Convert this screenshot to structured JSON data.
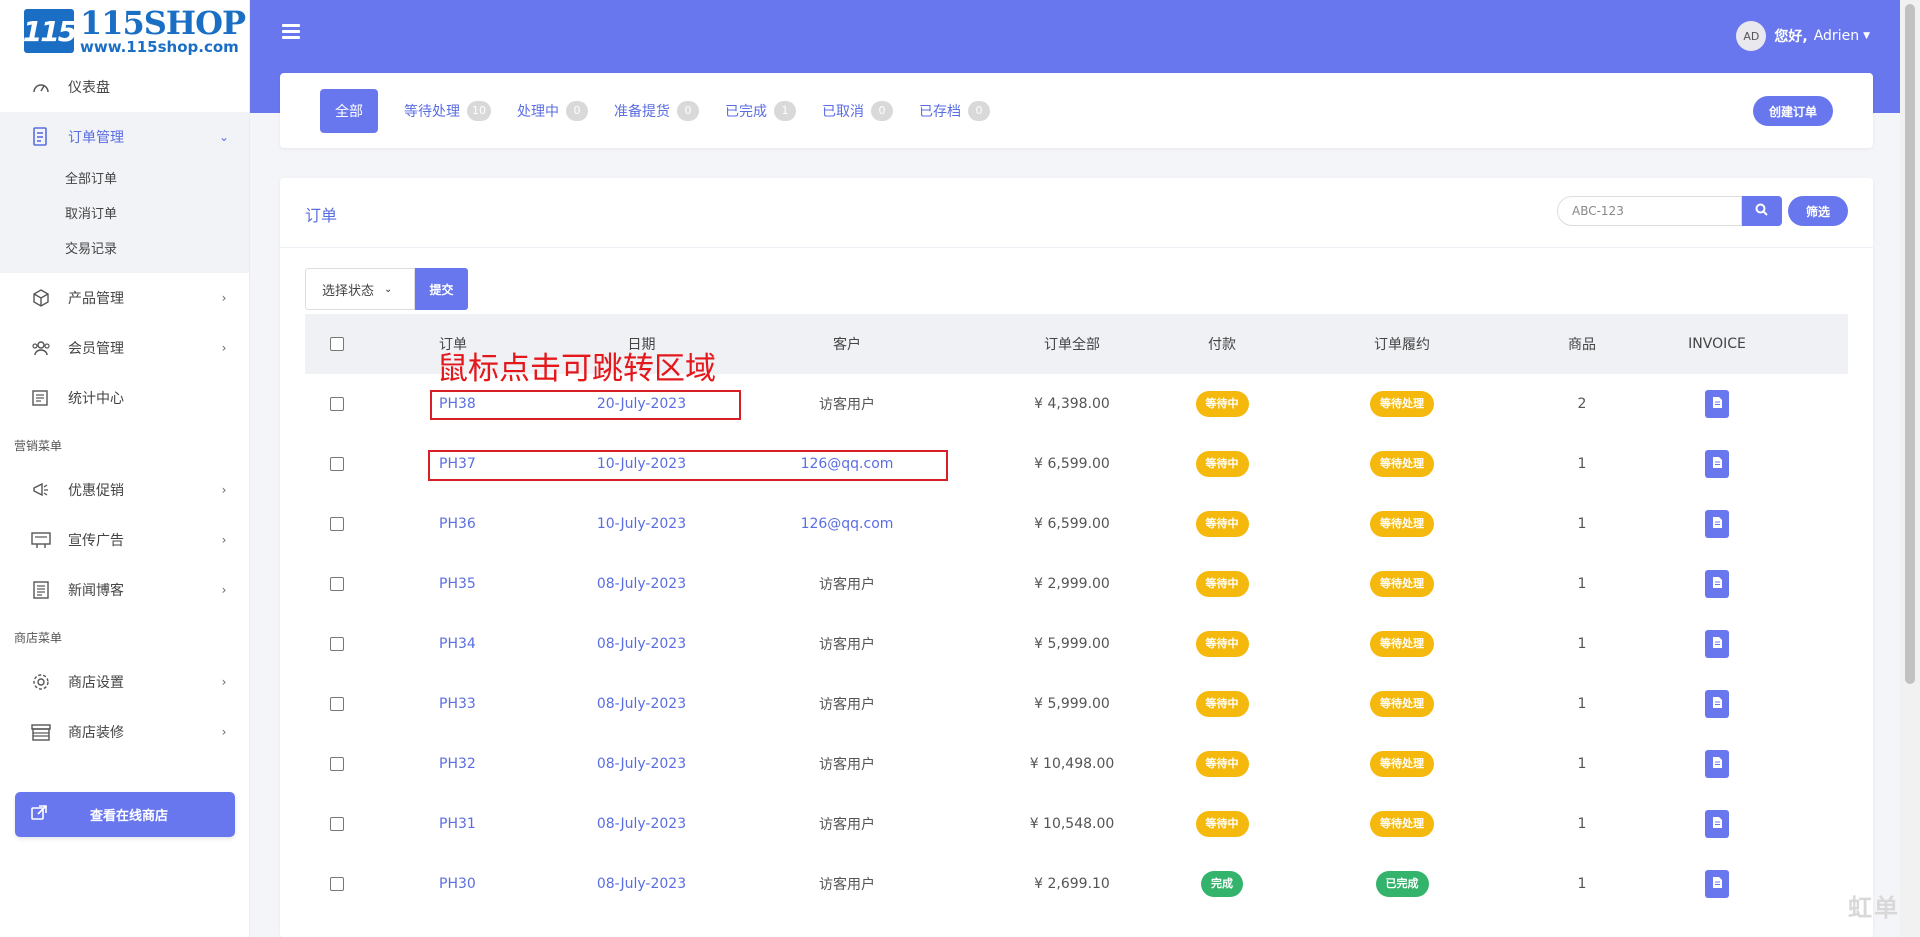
{
  "logo": {
    "mark": "115",
    "name": "115SHOP",
    "url": "www.115shop.com"
  },
  "sidebar": {
    "dashboard": "仪表盘",
    "orders": {
      "label": "订单管理",
      "children": [
        "全部订单",
        "取消订单",
        "交易记录"
      ]
    },
    "products": "产品管理",
    "members": "会员管理",
    "stats": "统计中心",
    "marketing_title": "营销菜单",
    "promo": "优惠促销",
    "ads": "宣传广告",
    "news": "新闻博客",
    "shop_title": "商店菜单",
    "shop_settings": "商店设置",
    "shop_decor": "商店装修",
    "online_store": "查看在线商店"
  },
  "header": {
    "avatar": "AD",
    "greeting": "您好,",
    "username": "Adrien"
  },
  "tabs": [
    {
      "label": "全部",
      "count": ""
    },
    {
      "label": "等待处理",
      "count": "10"
    },
    {
      "label": "处理中",
      "count": "0"
    },
    {
      "label": "准备提货",
      "count": "0"
    },
    {
      "label": "已完成",
      "count": "1"
    },
    {
      "label": "已取消",
      "count": "0"
    },
    {
      "label": "已存档",
      "count": "0"
    }
  ],
  "create_order": "创建订单",
  "orders": {
    "title": "订单",
    "search_value": "ABC-123",
    "filter": "筛选",
    "status_select": "选择状态",
    "submit": "提交",
    "columns": {
      "order": "订单",
      "date": "日期",
      "customer": "客户",
      "total": "订单全部",
      "payment": "付款",
      "fulfillment": "订单履约",
      "items": "商品",
      "invoice": "INVOICE"
    },
    "rows": [
      {
        "id": "PH38",
        "date": "20-July-2023",
        "customer": "访客用户",
        "customer_link": false,
        "total": "¥ 4,398.00",
        "payment": "等待中",
        "payment_status": "pending",
        "fulfillment": "等待处理",
        "fulfill_status": "pending",
        "items": "2"
      },
      {
        "id": "PH37",
        "date": "10-July-2023",
        "customer": "126@qq.com",
        "customer_link": true,
        "total": "¥ 6,599.00",
        "payment": "等待中",
        "payment_status": "pending",
        "fulfillment": "等待处理",
        "fulfill_status": "pending",
        "items": "1"
      },
      {
        "id": "PH36",
        "date": "10-July-2023",
        "customer": "126@qq.com",
        "customer_link": true,
        "total": "¥ 6,599.00",
        "payment": "等待中",
        "payment_status": "pending",
        "fulfillment": "等待处理",
        "fulfill_status": "pending",
        "items": "1"
      },
      {
        "id": "PH35",
        "date": "08-July-2023",
        "customer": "访客用户",
        "customer_link": false,
        "total": "¥ 2,999.00",
        "payment": "等待中",
        "payment_status": "pending",
        "fulfillment": "等待处理",
        "fulfill_status": "pending",
        "items": "1"
      },
      {
        "id": "PH34",
        "date": "08-July-2023",
        "customer": "访客用户",
        "customer_link": false,
        "total": "¥ 5,999.00",
        "payment": "等待中",
        "payment_status": "pending",
        "fulfillment": "等待处理",
        "fulfill_status": "pending",
        "items": "1"
      },
      {
        "id": "PH33",
        "date": "08-July-2023",
        "customer": "访客用户",
        "customer_link": false,
        "total": "¥ 5,999.00",
        "payment": "等待中",
        "payment_status": "pending",
        "fulfillment": "等待处理",
        "fulfill_status": "pending",
        "items": "1"
      },
      {
        "id": "PH32",
        "date": "08-July-2023",
        "customer": "访客用户",
        "customer_link": false,
        "total": "¥ 10,498.00",
        "payment": "等待中",
        "payment_status": "pending",
        "fulfillment": "等待处理",
        "fulfill_status": "pending",
        "items": "1"
      },
      {
        "id": "PH31",
        "date": "08-July-2023",
        "customer": "访客用户",
        "customer_link": false,
        "total": "¥ 10,548.00",
        "payment": "等待中",
        "payment_status": "pending",
        "fulfillment": "等待处理",
        "fulfill_status": "pending",
        "items": "1"
      },
      {
        "id": "PH30",
        "date": "08-July-2023",
        "customer": "访客用户",
        "customer_link": false,
        "total": "¥ 2,699.10",
        "payment": "完成",
        "payment_status": "done",
        "fulfillment": "已完成",
        "fulfill_status": "done",
        "items": "1"
      }
    ]
  },
  "annotation": {
    "text": "鼠标点击可跳转区域"
  },
  "watermark": "虹单",
  "colors": {
    "primary": "#6877ee",
    "pending": "#f5b80c",
    "done": "#33b36b",
    "annotation": "#e4181b"
  }
}
